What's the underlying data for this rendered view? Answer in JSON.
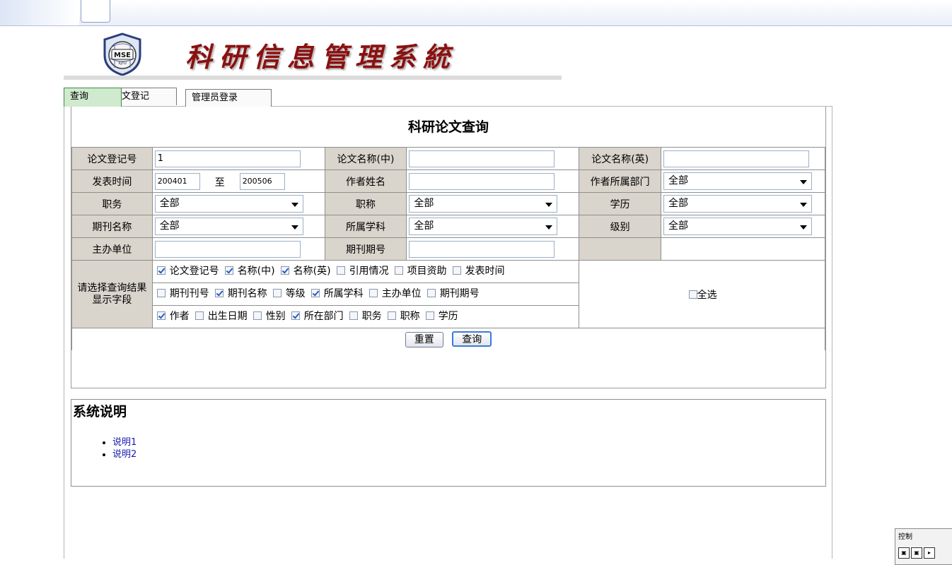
{
  "header": {
    "logo_text": "MSE",
    "logo_sub": "XJTU",
    "title": "科研信息管理系統"
  },
  "tabs": [
    {
      "label": "查询"
    },
    {
      "label": "论文登记"
    },
    {
      "label": "管理员登录"
    }
  ],
  "query": {
    "title": "科研论文查询",
    "row1": {
      "reg_no_label": "论文登记号",
      "reg_no_value": "1",
      "name_cn_label": "论文名称(中)",
      "name_cn_value": "",
      "name_en_label": "论文名称(英)",
      "name_en_value": ""
    },
    "row2": {
      "pub_time_label": "发表时间",
      "pub_from": "200401",
      "to_label": "至",
      "pub_to": "200506",
      "author_label": "作者姓名",
      "author_value": "",
      "dept_label": "作者所属部门",
      "dept_value": "全部"
    },
    "row3": {
      "duty_label": "职务",
      "duty_value": "全部",
      "title_label": "职称",
      "title_value": "全部",
      "edu_label": "学历",
      "edu_value": "全部"
    },
    "row4": {
      "journal_label": "期刊名称",
      "journal_value": "全部",
      "subject_label": "所属学科",
      "subject_value": "全部",
      "level_label": "级别",
      "level_value": "全部"
    },
    "row5": {
      "host_label": "主办单位",
      "host_value": "",
      "issue_label": "期刊期号",
      "issue_value": ""
    },
    "fields": {
      "label": "请选择查询结果显示字段",
      "line1": [
        {
          "label": "论文登记号",
          "checked": true
        },
        {
          "label": "名称(中)",
          "checked": true
        },
        {
          "label": "名称(英)",
          "checked": true
        },
        {
          "label": "引用情况",
          "checked": false
        },
        {
          "label": "项目资助",
          "checked": false
        },
        {
          "label": "发表时间",
          "checked": false
        }
      ],
      "line2": [
        {
          "label": "期刊刊号",
          "checked": false
        },
        {
          "label": "期刊名称",
          "checked": true
        },
        {
          "label": "等级",
          "checked": false
        },
        {
          "label": "所属学科",
          "checked": true
        },
        {
          "label": "主办单位",
          "checked": false
        },
        {
          "label": "期刊期号",
          "checked": false
        }
      ],
      "line3": [
        {
          "label": "作者",
          "checked": true
        },
        {
          "label": "出生日期",
          "checked": false
        },
        {
          "label": "性别",
          "checked": false
        },
        {
          "label": "所在部门",
          "checked": true
        },
        {
          "label": "职务",
          "checked": false
        },
        {
          "label": "职称",
          "checked": false
        },
        {
          "label": "学历",
          "checked": false
        }
      ],
      "select_all_label": "全选",
      "select_all_checked": false
    },
    "reset_label": "重置",
    "search_label": "查询"
  },
  "info": {
    "title": "系统说明",
    "items": [
      "说明1",
      "说明2"
    ]
  },
  "control_widget": {
    "title": "控制"
  }
}
